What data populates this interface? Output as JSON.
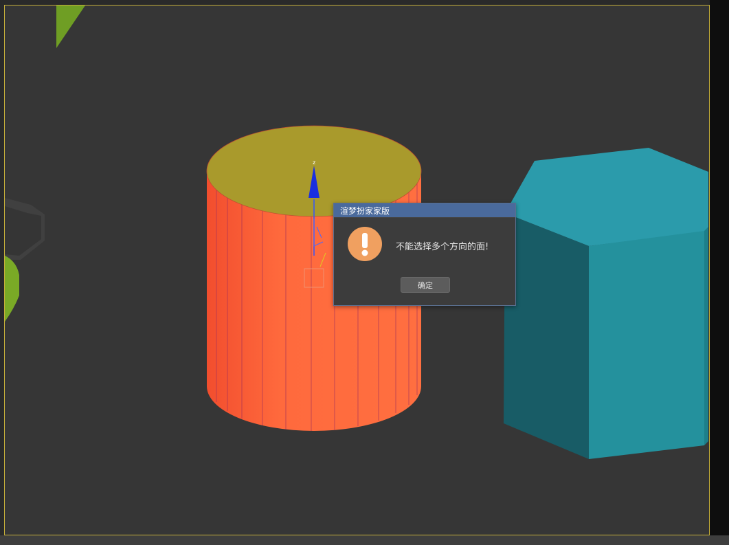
{
  "dialog": {
    "title": "渲梦扮家家版",
    "message": "不能选择多个方向的面!",
    "ok_label": "确定",
    "icon": "warning-icon"
  },
  "gizmo": {
    "axis_label": "z"
  },
  "colors": {
    "viewport_bg": "#363636",
    "viewport_border": "#c7b03a",
    "cylinder_side": "#ff6a3d",
    "cylinder_top": "#a99a2c",
    "hexprism_top": "#2b9bab",
    "hexprism_side_front": "#23909c",
    "hexprism_side_left": "#195f68",
    "green_object": "#6f9e24",
    "dialog_titlebar": "#4a6a9c",
    "warning_icon": "#f0a060"
  }
}
